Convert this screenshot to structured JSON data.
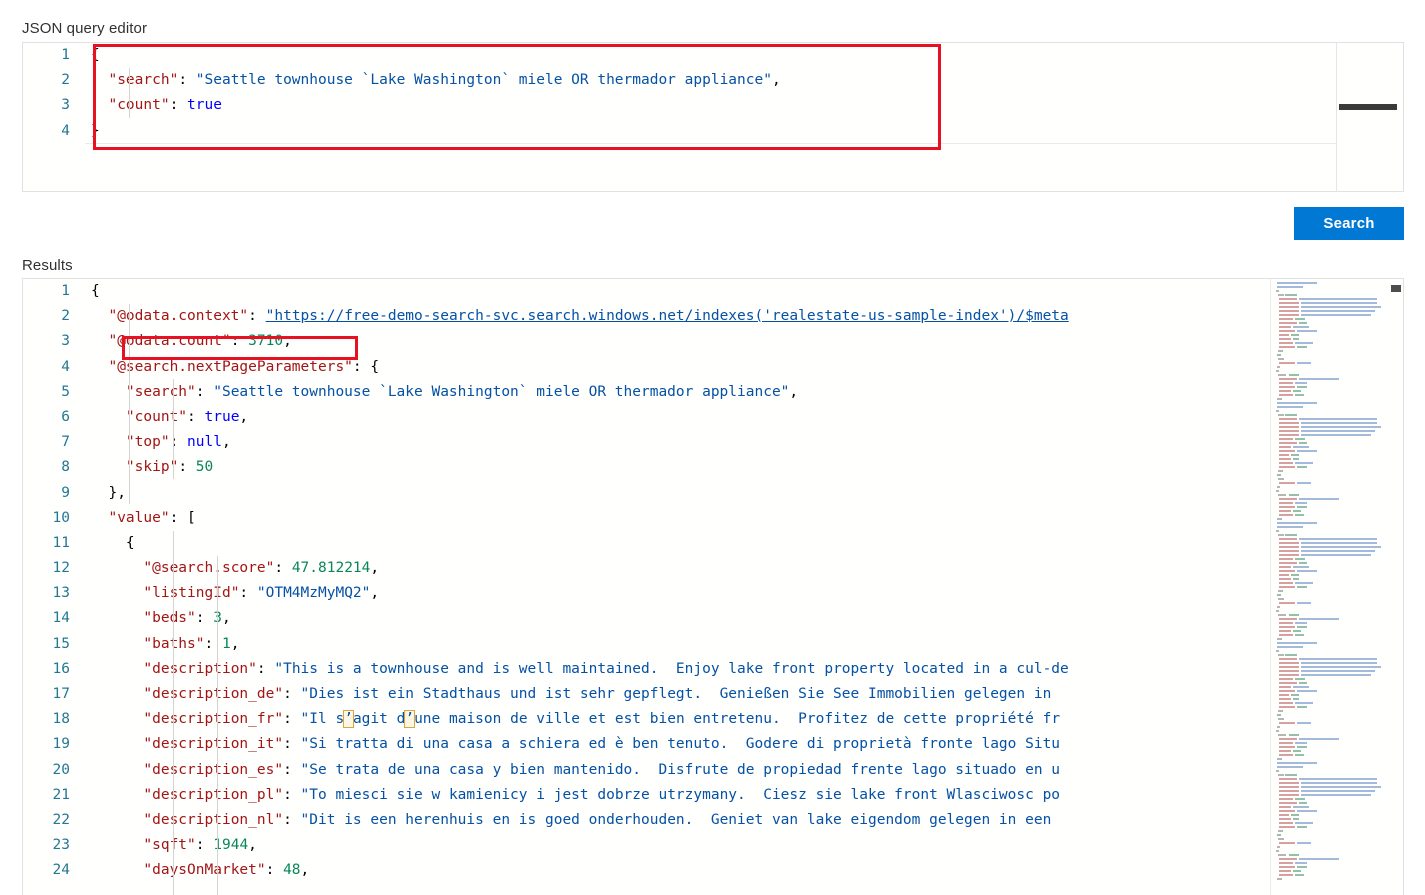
{
  "labels": {
    "json_editor": "JSON query editor",
    "results": "Results"
  },
  "buttons": {
    "search": "Search"
  },
  "colors": {
    "accent": "#0078d4",
    "annotation": "#e81123",
    "key": "#a31515",
    "string": "#0451a5",
    "number": "#098658",
    "boolean": "#0000ff",
    "line_number": "#237893"
  },
  "query_editor": {
    "line_numbers": [
      "1",
      "2",
      "3",
      "4"
    ],
    "lines": [
      [
        {
          "t": "{",
          "c": "p"
        }
      ],
      [
        {
          "t": "  ",
          "c": "p"
        },
        {
          "t": "\"search\"",
          "c": "k"
        },
        {
          "t": ": ",
          "c": "p"
        },
        {
          "t": "\"Seattle townhouse `Lake Washington` miele OR thermador appliance\"",
          "c": "s"
        },
        {
          "t": ",",
          "c": "p"
        }
      ],
      [
        {
          "t": "  ",
          "c": "p"
        },
        {
          "t": "\"count\"",
          "c": "k"
        },
        {
          "t": ": ",
          "c": "p"
        },
        {
          "t": "true",
          "c": "b"
        }
      ],
      [
        {
          "t": "}",
          "c": "p"
        }
      ]
    ]
  },
  "results_editor": {
    "line_numbers": [
      "1",
      "2",
      "3",
      "4",
      "5",
      "6",
      "7",
      "8",
      "9",
      "10",
      "11",
      "12",
      "13",
      "14",
      "15",
      "16",
      "17",
      "18",
      "19",
      "20",
      "21",
      "22",
      "23",
      "24"
    ],
    "lines": [
      [
        {
          "t": "{",
          "c": "p"
        }
      ],
      [
        {
          "t": "  ",
          "c": "p"
        },
        {
          "t": "\"@odata.context\"",
          "c": "k"
        },
        {
          "t": ": ",
          "c": "p"
        },
        {
          "t": "\"https://free-demo-search-svc.search.windows.net/indexes('realestate-us-sample-index')/$meta",
          "c": "u"
        }
      ],
      [
        {
          "t": "  ",
          "c": "p"
        },
        {
          "t": "\"@odata.count\"",
          "c": "k"
        },
        {
          "t": ": ",
          "c": "p"
        },
        {
          "t": "3710",
          "c": "n"
        },
        {
          "t": ",",
          "c": "p"
        }
      ],
      [
        {
          "t": "  ",
          "c": "p"
        },
        {
          "t": "\"@search.nextPageParameters\"",
          "c": "k"
        },
        {
          "t": ": {",
          "c": "p"
        }
      ],
      [
        {
          "t": "    ",
          "c": "p"
        },
        {
          "t": "\"search\"",
          "c": "k"
        },
        {
          "t": ": ",
          "c": "p"
        },
        {
          "t": "\"Seattle townhouse `Lake Washington` miele OR thermador appliance\"",
          "c": "s"
        },
        {
          "t": ",",
          "c": "p"
        }
      ],
      [
        {
          "t": "    ",
          "c": "p"
        },
        {
          "t": "\"count\"",
          "c": "k"
        },
        {
          "t": ": ",
          "c": "p"
        },
        {
          "t": "true",
          "c": "b"
        },
        {
          "t": ",",
          "c": "p"
        }
      ],
      [
        {
          "t": "    ",
          "c": "p"
        },
        {
          "t": "\"top\"",
          "c": "k"
        },
        {
          "t": ": ",
          "c": "p"
        },
        {
          "t": "null",
          "c": "b"
        },
        {
          "t": ",",
          "c": "p"
        }
      ],
      [
        {
          "t": "    ",
          "c": "p"
        },
        {
          "t": "\"skip\"",
          "c": "k"
        },
        {
          "t": ": ",
          "c": "p"
        },
        {
          "t": "50",
          "c": "n"
        }
      ],
      [
        {
          "t": "  },",
          "c": "p"
        }
      ],
      [
        {
          "t": "  ",
          "c": "p"
        },
        {
          "t": "\"value\"",
          "c": "k"
        },
        {
          "t": ": [",
          "c": "p"
        }
      ],
      [
        {
          "t": "    {",
          "c": "p"
        }
      ],
      [
        {
          "t": "      ",
          "c": "p"
        },
        {
          "t": "\"@search.score\"",
          "c": "k"
        },
        {
          "t": ": ",
          "c": "p"
        },
        {
          "t": "47.812214",
          "c": "n"
        },
        {
          "t": ",",
          "c": "p"
        }
      ],
      [
        {
          "t": "      ",
          "c": "p"
        },
        {
          "t": "\"listingId\"",
          "c": "k"
        },
        {
          "t": ": ",
          "c": "p"
        },
        {
          "t": "\"OTM4MzMyMQ2\"",
          "c": "s"
        },
        {
          "t": ",",
          "c": "p"
        }
      ],
      [
        {
          "t": "      ",
          "c": "p"
        },
        {
          "t": "\"beds\"",
          "c": "k"
        },
        {
          "t": ": ",
          "c": "p"
        },
        {
          "t": "3",
          "c": "n"
        },
        {
          "t": ",",
          "c": "p"
        }
      ],
      [
        {
          "t": "      ",
          "c": "p"
        },
        {
          "t": "\"baths\"",
          "c": "k"
        },
        {
          "t": ": ",
          "c": "p"
        },
        {
          "t": "1",
          "c": "n"
        },
        {
          "t": ",",
          "c": "p"
        }
      ],
      [
        {
          "t": "      ",
          "c": "p"
        },
        {
          "t": "\"description\"",
          "c": "k"
        },
        {
          "t": ": ",
          "c": "p"
        },
        {
          "t": "\"This is a townhouse and is well maintained.  Enjoy lake front property located in a cul-de",
          "c": "s"
        }
      ],
      [
        {
          "t": "      ",
          "c": "p"
        },
        {
          "t": "\"description_de\"",
          "c": "k"
        },
        {
          "t": ": ",
          "c": "p"
        },
        {
          "t": "\"Dies ist ein Stadthaus und ist sehr gepflegt.  Genießen Sie See Immobilien gelegen in ",
          "c": "s"
        }
      ],
      [
        {
          "t": "      ",
          "c": "p"
        },
        {
          "t": "\"description_fr\"",
          "c": "k"
        },
        {
          "t": ": ",
          "c": "p"
        },
        {
          "t": "\"Il s",
          "c": "s"
        },
        {
          "t": "’",
          "c": "s hl"
        },
        {
          "t": "agit d",
          "c": "s"
        },
        {
          "t": "’",
          "c": "s hl"
        },
        {
          "t": "une maison de ville et est bien entretenu.  Profitez de cette propriété fr",
          "c": "s"
        }
      ],
      [
        {
          "t": "      ",
          "c": "p"
        },
        {
          "t": "\"description_it\"",
          "c": "k"
        },
        {
          "t": ": ",
          "c": "p"
        },
        {
          "t": "\"Si tratta di una casa a schiera ed è ben tenuto.  Godere di proprietà fronte lago Situ",
          "c": "s"
        }
      ],
      [
        {
          "t": "      ",
          "c": "p"
        },
        {
          "t": "\"description_es\"",
          "c": "k"
        },
        {
          "t": ": ",
          "c": "p"
        },
        {
          "t": "\"Se trata de una casa y bien mantenido.  Disfrute de propiedad frente lago situado en u",
          "c": "s"
        }
      ],
      [
        {
          "t": "      ",
          "c": "p"
        },
        {
          "t": "\"description_pl\"",
          "c": "k"
        },
        {
          "t": ": ",
          "c": "p"
        },
        {
          "t": "\"To miesci sie w kamienicy i jest dobrze utrzymany.  Ciesz sie lake front Wlasciwosc po",
          "c": "s"
        }
      ],
      [
        {
          "t": "      ",
          "c": "p"
        },
        {
          "t": "\"description_nl\"",
          "c": "k"
        },
        {
          "t": ": ",
          "c": "p"
        },
        {
          "t": "\"Dit is een herenhuis en is goed onderhouden.  Geniet van lake eigendom gelegen in een ",
          "c": "s"
        }
      ],
      [
        {
          "t": "      ",
          "c": "p"
        },
        {
          "t": "\"sqft\"",
          "c": "k"
        },
        {
          "t": ": ",
          "c": "p"
        },
        {
          "t": "1944",
          "c": "n"
        },
        {
          "t": ",",
          "c": "p"
        }
      ],
      [
        {
          "t": "      ",
          "c": "p"
        },
        {
          "t": "\"daysOnMarket\"",
          "c": "k"
        },
        {
          "t": ": ",
          "c": "p"
        },
        {
          "t": "48",
          "c": "n"
        },
        {
          "t": ",",
          "c": "p"
        }
      ]
    ]
  },
  "annotations": [
    {
      "name": "query-highlight",
      "target": "json query body"
    },
    {
      "name": "count-highlight",
      "target": "@odata.count 3710"
    }
  ],
  "minimap": {
    "present": true,
    "rows": 150
  }
}
